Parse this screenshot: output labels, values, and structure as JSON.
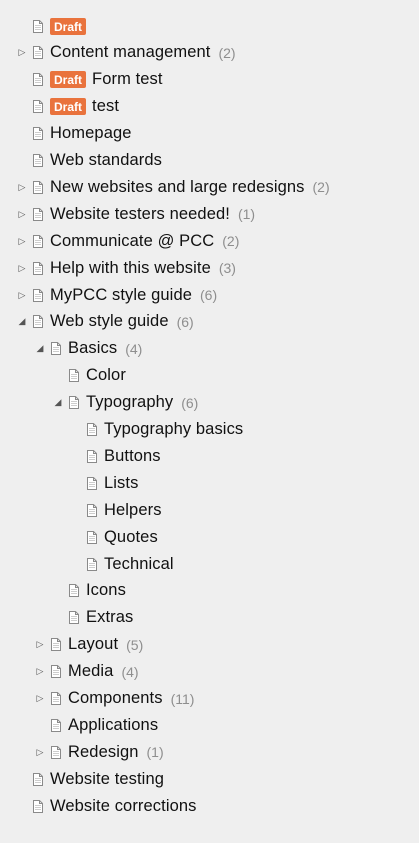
{
  "draft_label": "Draft",
  "items": [
    {
      "title": "",
      "count": "",
      "draft": true,
      "toggle": "none",
      "depth": 0
    },
    {
      "title": "Content management",
      "count": "(2)",
      "draft": false,
      "toggle": "collapsed",
      "depth": 0
    },
    {
      "title": "Form test",
      "count": "",
      "draft": true,
      "toggle": "none",
      "depth": 0
    },
    {
      "title": "test",
      "count": "",
      "draft": true,
      "toggle": "none",
      "depth": 0
    },
    {
      "title": "Homepage",
      "count": "",
      "draft": false,
      "toggle": "none",
      "depth": 0
    },
    {
      "title": "Web standards",
      "count": "",
      "draft": false,
      "toggle": "none",
      "depth": 0
    },
    {
      "title": "New websites and large redesigns",
      "count": "(2)",
      "draft": false,
      "toggle": "collapsed",
      "depth": 0
    },
    {
      "title": "Website testers needed!",
      "count": "(1)",
      "draft": false,
      "toggle": "collapsed",
      "depth": 0
    },
    {
      "title": "Communicate @ PCC",
      "count": "(2)",
      "draft": false,
      "toggle": "collapsed",
      "depth": 0
    },
    {
      "title": "Help with this website",
      "count": "(3)",
      "draft": false,
      "toggle": "collapsed",
      "depth": 0
    },
    {
      "title": "MyPCC style guide",
      "count": "(6)",
      "draft": false,
      "toggle": "collapsed",
      "depth": 0
    },
    {
      "title": "Web style guide",
      "count": "(6)",
      "draft": false,
      "toggle": "expanded",
      "depth": 0
    },
    {
      "title": "Basics",
      "count": "(4)",
      "draft": false,
      "toggle": "expanded",
      "depth": 1
    },
    {
      "title": "Color",
      "count": "",
      "draft": false,
      "toggle": "none",
      "depth": 2
    },
    {
      "title": "Typography",
      "count": "(6)",
      "draft": false,
      "toggle": "expanded",
      "depth": 2
    },
    {
      "title": "Typography basics",
      "count": "",
      "draft": false,
      "toggle": "none",
      "depth": 3
    },
    {
      "title": "Buttons",
      "count": "",
      "draft": false,
      "toggle": "none",
      "depth": 3
    },
    {
      "title": "Lists",
      "count": "",
      "draft": false,
      "toggle": "none",
      "depth": 3
    },
    {
      "title": "Helpers",
      "count": "",
      "draft": false,
      "toggle": "none",
      "depth": 3
    },
    {
      "title": "Quotes",
      "count": "",
      "draft": false,
      "toggle": "none",
      "depth": 3
    },
    {
      "title": "Technical",
      "count": "",
      "draft": false,
      "toggle": "none",
      "depth": 3
    },
    {
      "title": "Icons",
      "count": "",
      "draft": false,
      "toggle": "none",
      "depth": 2
    },
    {
      "title": "Extras",
      "count": "",
      "draft": false,
      "toggle": "none",
      "depth": 2
    },
    {
      "title": "Layout",
      "count": "(5)",
      "draft": false,
      "toggle": "collapsed",
      "depth": 1
    },
    {
      "title": "Media",
      "count": "(4)",
      "draft": false,
      "toggle": "collapsed",
      "depth": 1
    },
    {
      "title": "Components",
      "count": "(11)",
      "draft": false,
      "toggle": "collapsed",
      "depth": 1
    },
    {
      "title": "Applications",
      "count": "",
      "draft": false,
      "toggle": "none",
      "depth": 1
    },
    {
      "title": "Redesign",
      "count": "(1)",
      "draft": false,
      "toggle": "collapsed",
      "depth": 1
    },
    {
      "title": "Website testing",
      "count": "",
      "draft": false,
      "toggle": "none",
      "depth": 0
    },
    {
      "title": "Website corrections",
      "count": "",
      "draft": false,
      "toggle": "none",
      "depth": 0
    }
  ]
}
